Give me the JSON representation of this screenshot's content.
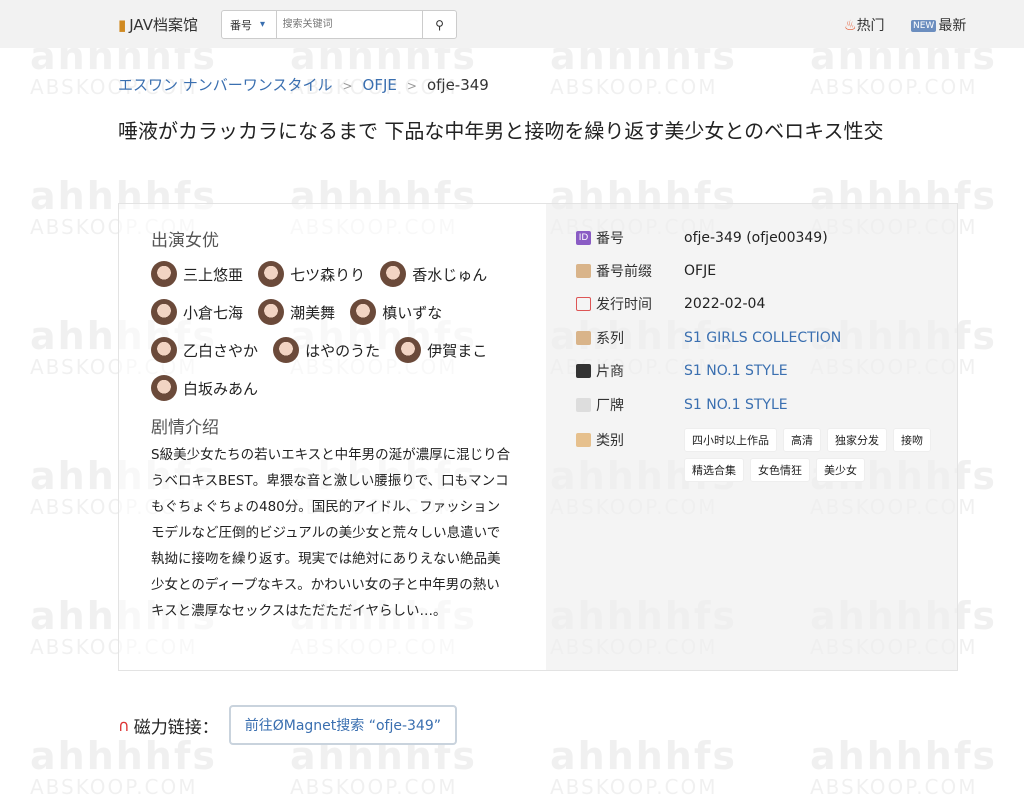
{
  "header": {
    "logo": "JAV档案馆",
    "search_select": "番号",
    "search_placeholder": "搜索关键词",
    "nav_hot": "热门",
    "nav_new": "最新",
    "nav_new_icon_text": "NEW"
  },
  "breadcrumb": [
    "エスワン ナンバーワンスタイル",
    "OFJE",
    "ofje-349"
  ],
  "title": "唾液がカラッカラになるまで 下品な中年男と接吻を繰り返す美少女とのベロキス性交",
  "actresses_heading": "出演女优",
  "actresses": [
    "三上悠亜",
    "七ツ森りり",
    "香水じゅん",
    "小倉七海",
    "潮美舞",
    "槙いずな",
    "乙白さやか",
    "はやのうた",
    "伊賀まこ",
    "白坂みあん"
  ],
  "plot_heading": "剧情介绍",
  "plot": "S級美少女たちの若いエキスと中年男の涎が濃厚に混じり合うベロキスBEST。卑猥な音と激しい腰振りで、口もマンコもぐちょぐちょの480分。国民的アイドル、ファッションモデルなど圧倒的ビジュアルの美少女と荒々しい息遣いで執拗に接吻を繰り返す。現実では絶対にありえない絶品美少女とのディープなキス。かわいい女の子と中年男の熱いキスと濃厚なセックスはただただイヤらしい…。",
  "details": {
    "id_label": "番号",
    "id_icon_text": "ID",
    "id_value": "ofje-349 (ofje00349)",
    "prefix_label": "番号前缀",
    "prefix_value": "OFJE",
    "date_label": "发行时间",
    "date_value": "2022-02-04",
    "series_label": "系列",
    "series_value": "S1 GIRLS COLLECTION",
    "maker_label": "片商",
    "maker_value": "S1 NO.1 STYLE",
    "label_label": "厂牌",
    "label_value": "S1 NO.1 STYLE",
    "genre_label": "类别"
  },
  "genres": [
    "四小时以上作品",
    "高清",
    "独家分发",
    "接吻",
    "精选合集",
    "女色情狂",
    "美少女"
  ],
  "magnet": {
    "label": "磁力链接：",
    "button": "前往ØMagnet搜索 “ofje-349”"
  },
  "watermark": {
    "big": "ahhhhfs",
    "small": "ABSKOOP.COM"
  },
  "colors": {
    "link": "#3a6fb0",
    "topbar": "#f2f2f2",
    "panel": "#eeeeee"
  }
}
